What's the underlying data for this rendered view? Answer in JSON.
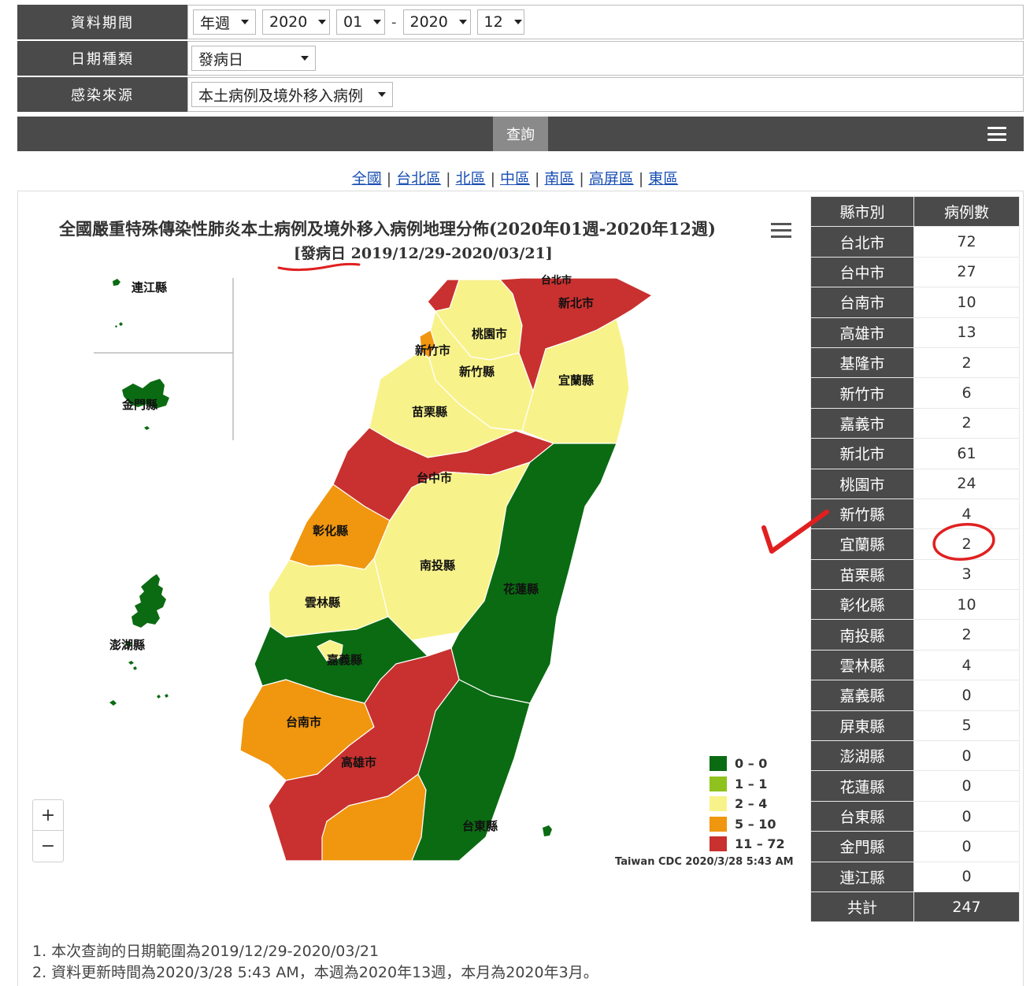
{
  "filters": {
    "period": {
      "label": "資料期間",
      "type": "年週",
      "start_year": "2020",
      "start_week": "01",
      "separator": "-",
      "end_year": "2020",
      "end_week": "12"
    },
    "date_type": {
      "label": "日期種類",
      "value": "發病日"
    },
    "source": {
      "label": "感染來源",
      "value": "本土病例及境外移入病例"
    },
    "query_label": "查詢"
  },
  "regions": [
    "全國",
    "台北區",
    "北區",
    "中區",
    "南區",
    "高屏區",
    "東區"
  ],
  "map": {
    "title": "全國嚴重特殊傳染性肺炎本土病例及境外移入病例地理分佈(2020年01週-2020年12週)",
    "subtitle": "[發病日 2019/12/29-2020/03/21]",
    "zoom_in": "+",
    "zoom_out": "−",
    "credits": "Taiwan CDC 2020/3/28 5:43 AM",
    "labels": {
      "lienchiang": "連江縣",
      "kinmen": "金門縣",
      "penghu": "澎湖縣",
      "taipei": "台北市",
      "newtaipei": "新北市",
      "taoyuan": "桃園市",
      "hsinchucity": "新竹市",
      "hsinchucounty": "新竹縣",
      "yilan": "宜蘭縣",
      "miaoli": "苗栗縣",
      "taichung": "台中市",
      "changhua": "彰化縣",
      "nantou": "南投縣",
      "hualien": "花蓮縣",
      "yunlin": "雲林縣",
      "chiayi": "嘉義縣",
      "tainan": "台南市",
      "kaohsiung": "高雄市",
      "taitung": "台東縣"
    },
    "legend": [
      {
        "label": "0 – 0",
        "color": "#0b6b12"
      },
      {
        "label": "1 – 1",
        "color": "#8fc21d"
      },
      {
        "label": "2 – 4",
        "color": "#f8f28a"
      },
      {
        "label": "5 – 10",
        "color": "#f0960f"
      },
      {
        "label": "11 – 72",
        "color": "#c8312f"
      }
    ]
  },
  "cases": {
    "header": {
      "county": "縣市別",
      "count": "病例數"
    },
    "rows": [
      {
        "county": "台北市",
        "count": "72"
      },
      {
        "county": "台中市",
        "count": "27"
      },
      {
        "county": "台南市",
        "count": "10"
      },
      {
        "county": "高雄市",
        "count": "13"
      },
      {
        "county": "基隆市",
        "count": "2"
      },
      {
        "county": "新竹市",
        "count": "6"
      },
      {
        "county": "嘉義市",
        "count": "2"
      },
      {
        "county": "新北市",
        "count": "61"
      },
      {
        "county": "桃園市",
        "count": "24"
      },
      {
        "county": "新竹縣",
        "count": "4"
      },
      {
        "county": "宜蘭縣",
        "count": "2"
      },
      {
        "county": "苗栗縣",
        "count": "3"
      },
      {
        "county": "彰化縣",
        "count": "10"
      },
      {
        "county": "南投縣",
        "count": "2"
      },
      {
        "county": "雲林縣",
        "count": "4"
      },
      {
        "county": "嘉義縣",
        "count": "0"
      },
      {
        "county": "屏東縣",
        "count": "5"
      },
      {
        "county": "澎湖縣",
        "count": "0"
      },
      {
        "county": "花蓮縣",
        "count": "0"
      },
      {
        "county": "台東縣",
        "count": "0"
      },
      {
        "county": "金門縣",
        "count": "0"
      },
      {
        "county": "連江縣",
        "count": "0"
      }
    ],
    "total": {
      "label": "共計",
      "count": "247"
    }
  },
  "notes": [
    "1. 本次查詢的日期範圍為2019/12/29-2020/03/21",
    "2. 資料更新時間為2020/3/28 5:43 AM，本週為2020年13週，本月為2020年3月。"
  ],
  "colors": {
    "header_bg": "#4a4a4a",
    "link": "#1a4fb3",
    "annotation": "#e02020"
  }
}
